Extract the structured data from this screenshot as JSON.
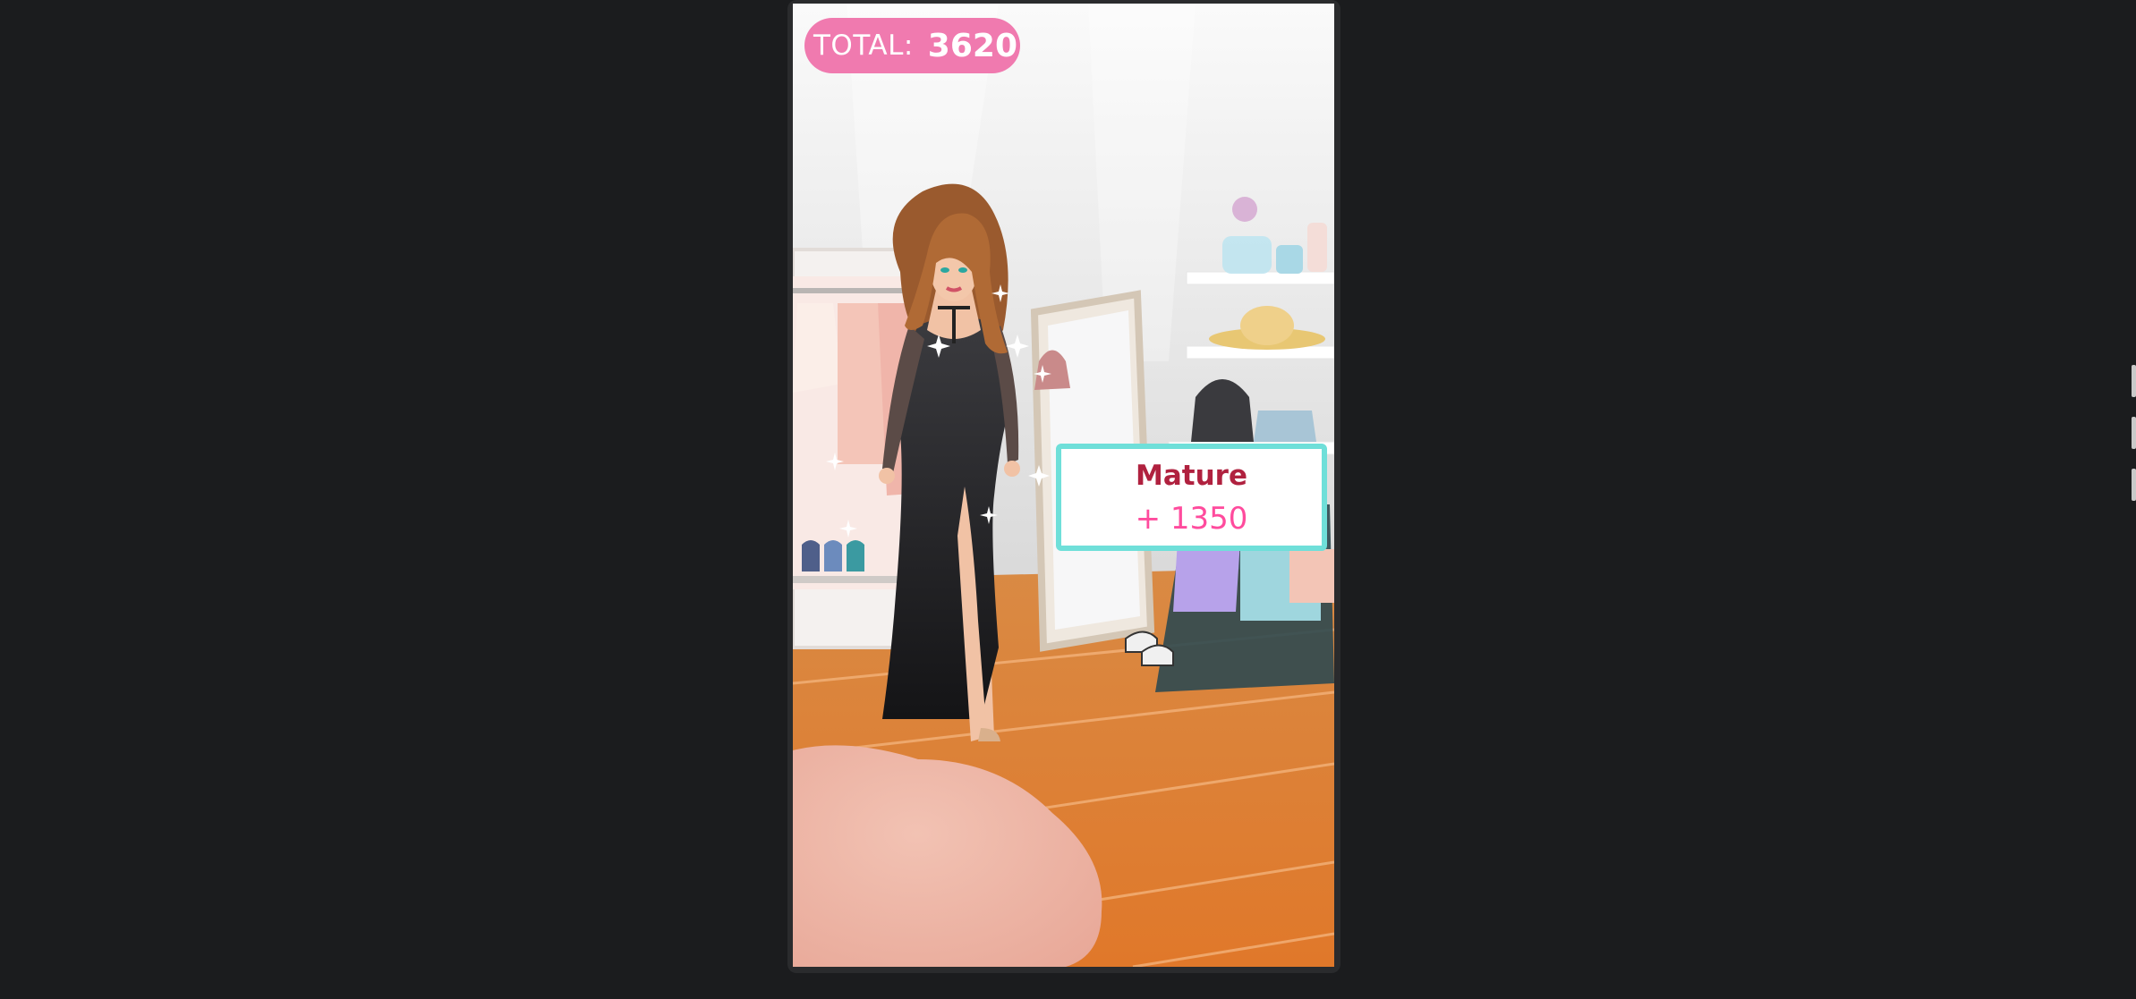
{
  "hud": {
    "total_label": "TOTAL:",
    "total_value": "3620"
  },
  "result": {
    "style_name": "Mature",
    "points": "+ 1350"
  },
  "colors": {
    "pill": "#f07aaf",
    "card_border": "#6fdfd9",
    "title": "#b0213f",
    "points": "#ff4b9d"
  },
  "icons": [
    "sparkle-icon"
  ]
}
